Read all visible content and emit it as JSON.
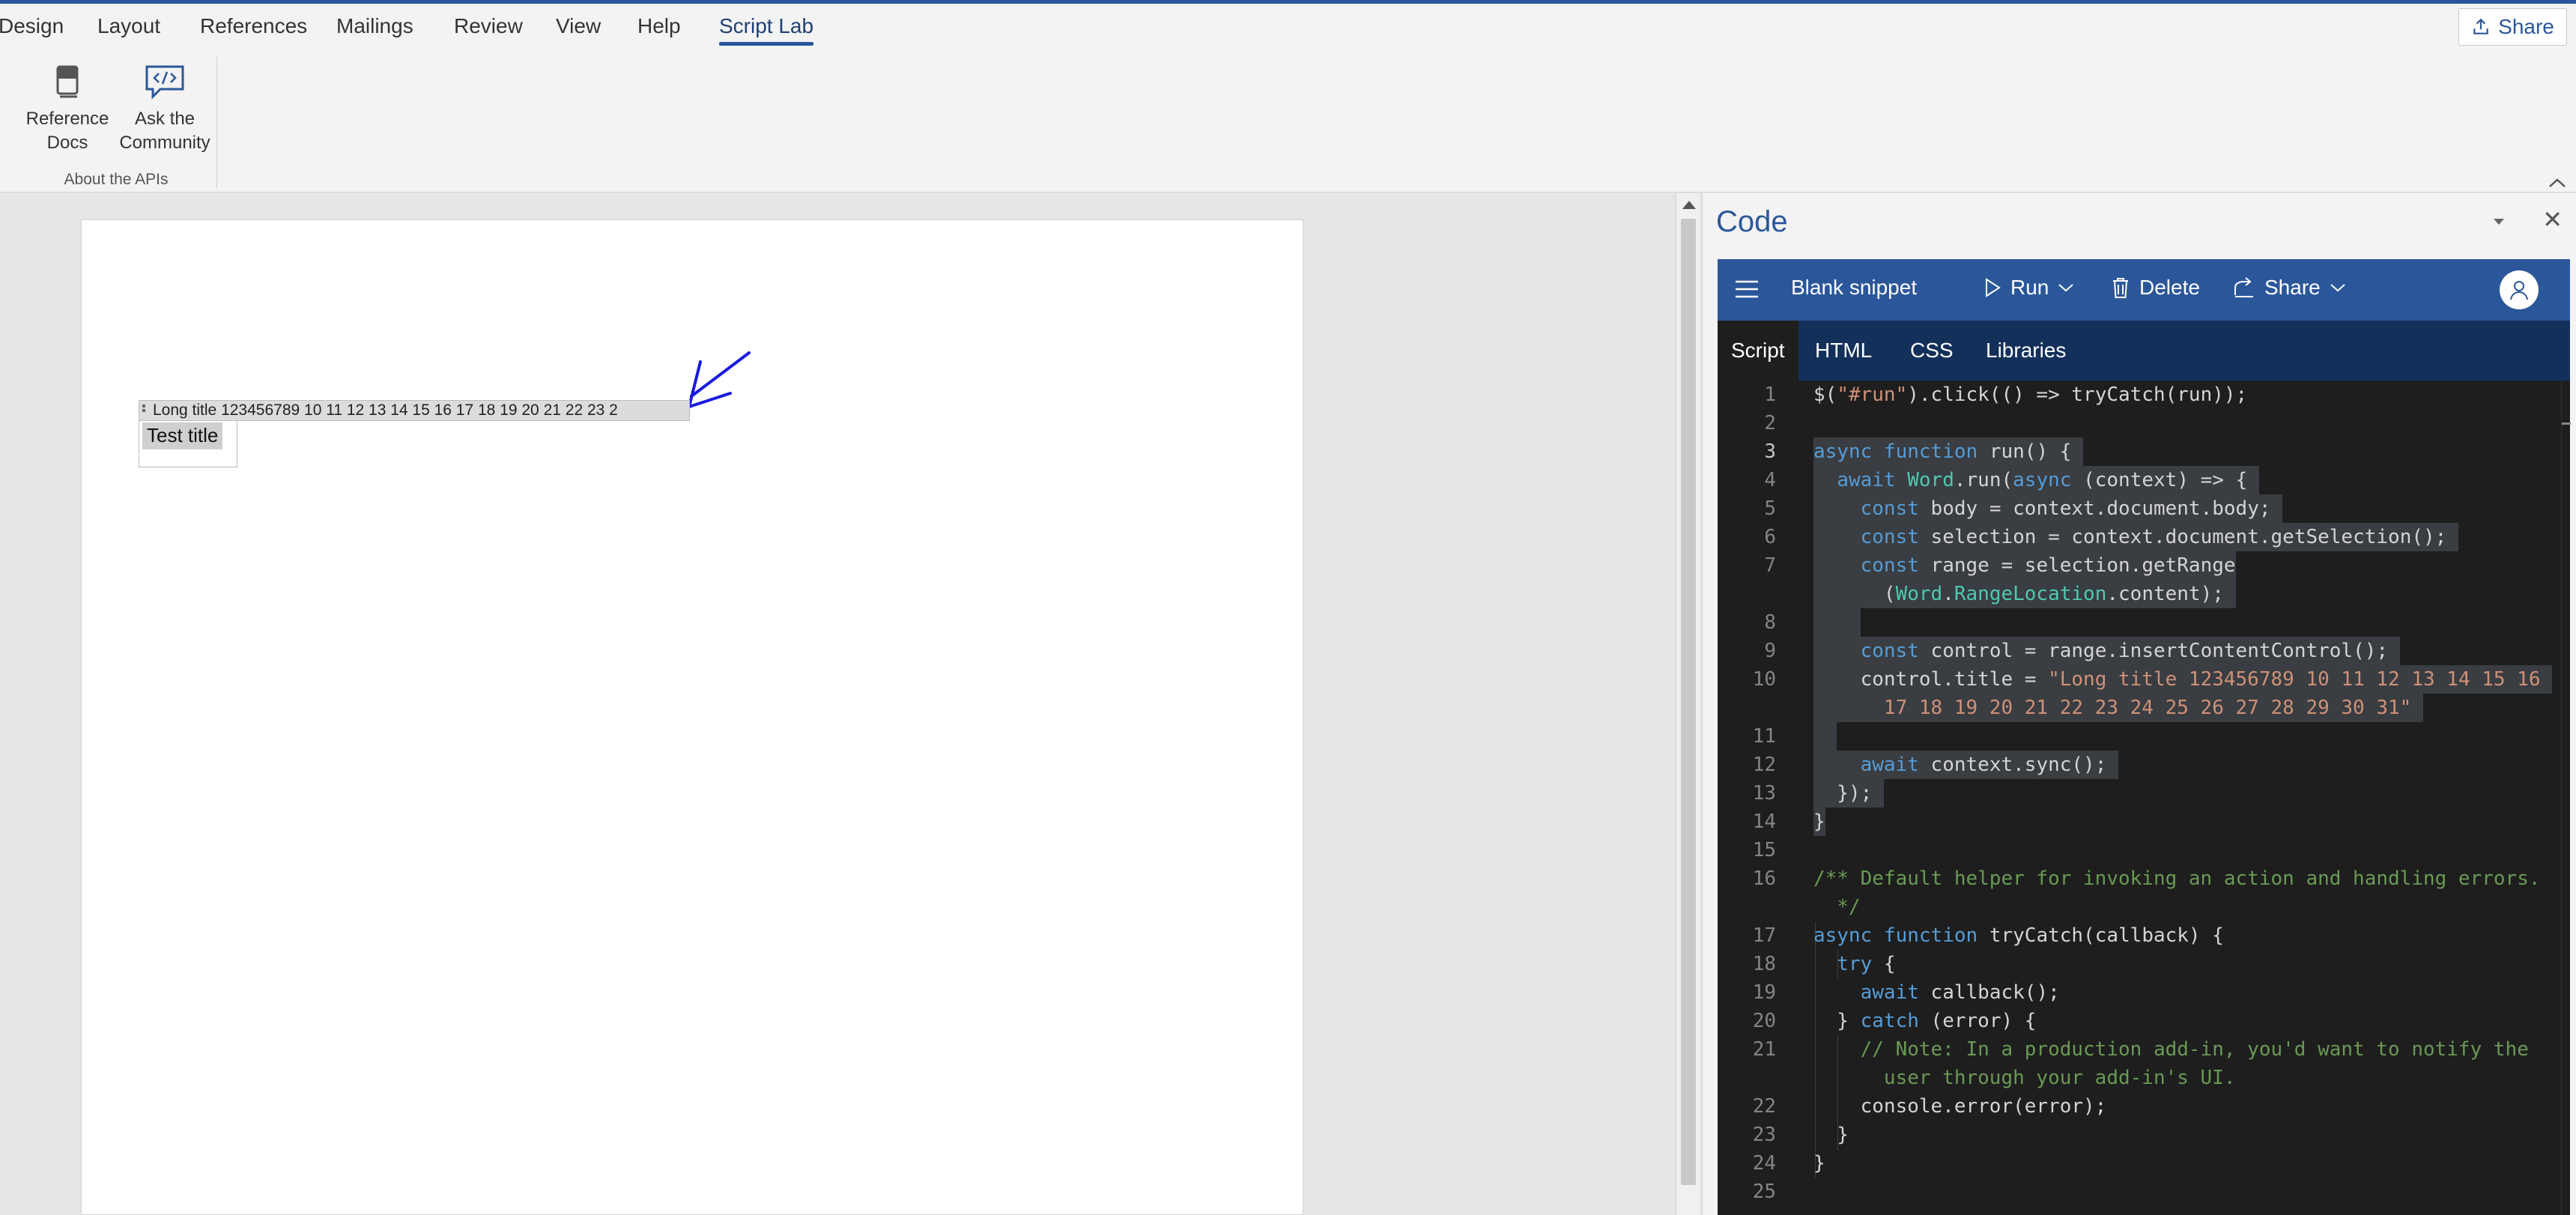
{
  "ribbon": {
    "tabs": [
      "Design",
      "Layout",
      "References",
      "Mailings",
      "Review",
      "View",
      "Help",
      "Script Lab"
    ],
    "active_tab": "Script Lab",
    "share_label": "Share",
    "group": {
      "buttons": [
        {
          "line1": "Reference",
          "line2": "Docs",
          "icon": "book-icon"
        },
        {
          "line1": "Ask the",
          "line2": "Community",
          "icon": "chat-code-icon"
        }
      ],
      "label": "About the APIs"
    }
  },
  "document": {
    "content_control_title": "Long title 123456789 10 11 12 13 14 15 16 17 18 19 20 21 22 23 2",
    "content_control_text": "Test title"
  },
  "pane": {
    "title": "Code",
    "command_bar": {
      "snippet_name": "Blank snippet",
      "run_label": "Run",
      "delete_label": "Delete",
      "share_label": "Share"
    },
    "tabs": [
      "Script",
      "HTML",
      "CSS",
      "Libraries"
    ],
    "active_tab": "Script",
    "line_numbers": [
      "1",
      "2",
      "3",
      "4",
      "5",
      "6",
      "7",
      "",
      "8",
      "9",
      "10",
      "",
      "11",
      "12",
      "13",
      "14",
      "15",
      "16",
      "",
      "17",
      "18",
      "19",
      "20",
      "21",
      "",
      "22",
      "23",
      "24",
      "25"
    ]
  },
  "colors": {
    "accent": "#2b579a",
    "editor_bg": "#1e1e1e",
    "keyword": "#569cd6",
    "string": "#ce9178",
    "comment": "#6a9955",
    "class": "#4ec9b0"
  }
}
